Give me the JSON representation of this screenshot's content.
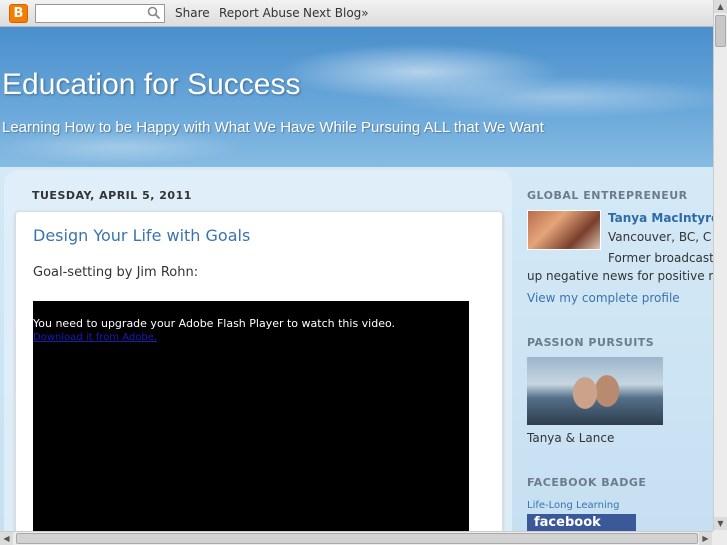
{
  "navbar": {
    "logo_letter": "B",
    "search_placeholder": "",
    "share_label": "Share",
    "report_label": "Report Abuse",
    "next_label": "Next Blog»"
  },
  "header": {
    "title": "Education for Success",
    "description": "Learning How to be Happy with What We Have While Pursuing ALL that We Want"
  },
  "post": {
    "date": "TUESDAY, APRIL 5, 2011",
    "title": "Design Your Life with Goals",
    "intro": "Goal-setting by Jim Rohn:",
    "flash_message": "You need to upgrade your Adobe Flash Player to watch this video.",
    "flash_link": "Download it from Adobe."
  },
  "sidebar": {
    "profile": {
      "heading": "GLOBAL ENTREPRENEUR",
      "name": "Tanya MacIntyre",
      "location": "Vancouver, BC, C",
      "bio_line1": "Former broadcast",
      "bio_line2": "up negative news for positive me",
      "view_profile": "View my complete profile"
    },
    "passion": {
      "heading": "PASSION PURSUITS",
      "caption": "Tanya & Lance"
    },
    "facebook": {
      "heading": "FACEBOOK BADGE",
      "badge_label": "Life-Long Learning",
      "badge_logo": "facebook"
    }
  },
  "colors": {
    "title_link": "#3a74b0",
    "facebook_blue": "#3b5998",
    "blogger_orange": "#f57d00"
  }
}
